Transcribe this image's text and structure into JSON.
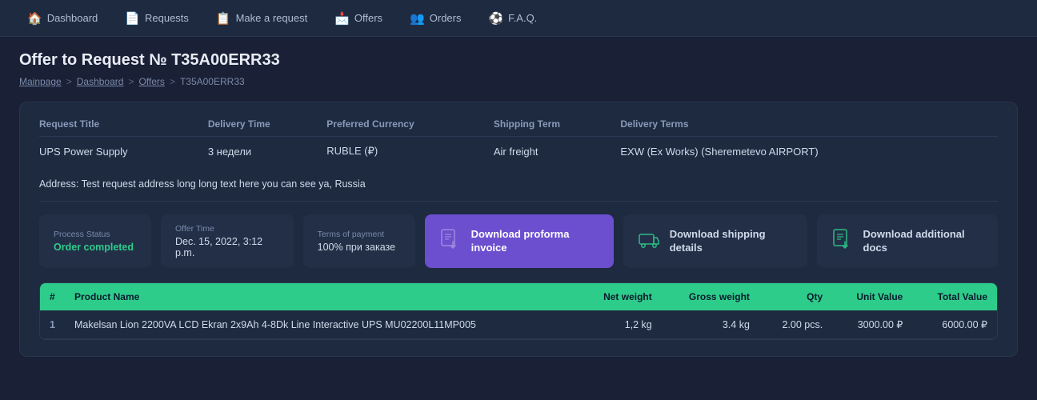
{
  "app": {
    "title": "Offer to Request"
  },
  "nav": {
    "items": [
      {
        "id": "dashboard",
        "label": "Dashboard",
        "icon": "🏠"
      },
      {
        "id": "requests",
        "label": "Requests",
        "icon": "📄"
      },
      {
        "id": "make-request",
        "label": "Make a request",
        "icon": "📋"
      },
      {
        "id": "offers",
        "label": "Offers",
        "icon": "📩"
      },
      {
        "id": "orders",
        "label": "Orders",
        "icon": "👥"
      },
      {
        "id": "faq",
        "label": "F.A.Q.",
        "icon": "⚽"
      }
    ]
  },
  "breadcrumb": {
    "items": [
      {
        "label": "Mainpage",
        "link": true
      },
      {
        "label": "Dashboard",
        "link": true
      },
      {
        "label": "Offers",
        "link": true
      },
      {
        "label": "T35A00ERR33",
        "link": false
      }
    ]
  },
  "page": {
    "title": "Offer to Request № T35A00ERR33"
  },
  "info": {
    "columns": [
      "Request Title",
      "Delivery Time",
      "Preferred Currency",
      "Shipping Term",
      "Delivery Terms"
    ],
    "values": [
      "UPS Power Supply",
      "3 недели",
      "RUBLE (₽)",
      "Air freight",
      "EXW (Ex Works) (Sheremetevo AIRPORT)"
    ],
    "address_label": "Address:",
    "address_value": "Test request address long long text here you can see ya, Russia"
  },
  "actions": {
    "process_status_label": "Process Status",
    "process_status_value": "Order completed",
    "offer_time_label": "Offer Time",
    "offer_time_value": "Dec. 15, 2022, 3:12 p.m.",
    "payment_label": "Terms of payment",
    "payment_value": "100% при заказе",
    "btn_proforma_label": "Download proforma invoice",
    "btn_shipping_label": "Download shipping details",
    "btn_docs_label": "Download additional docs"
  },
  "table": {
    "columns": [
      {
        "id": "num",
        "label": "#"
      },
      {
        "id": "product",
        "label": "Product Name"
      },
      {
        "id": "net",
        "label": "Net weight",
        "align": "right"
      },
      {
        "id": "gross",
        "label": "Gross weight",
        "align": "right"
      },
      {
        "id": "qty",
        "label": "Qty",
        "align": "right"
      },
      {
        "id": "unit",
        "label": "Unit Value",
        "align": "right"
      },
      {
        "id": "total",
        "label": "Total Value",
        "align": "right"
      }
    ],
    "rows": [
      {
        "num": "1",
        "product": "Makelsan Lion 2200VA LCD Ekran 2x9Ah 4-8Dk Line Interactive UPS MU02200L11MP005",
        "net": "1,2 kg",
        "gross": "3.4 kg",
        "qty": "2.00 pcs.",
        "unit": "3000.00 ₽",
        "total": "6000.00 ₽"
      }
    ]
  }
}
